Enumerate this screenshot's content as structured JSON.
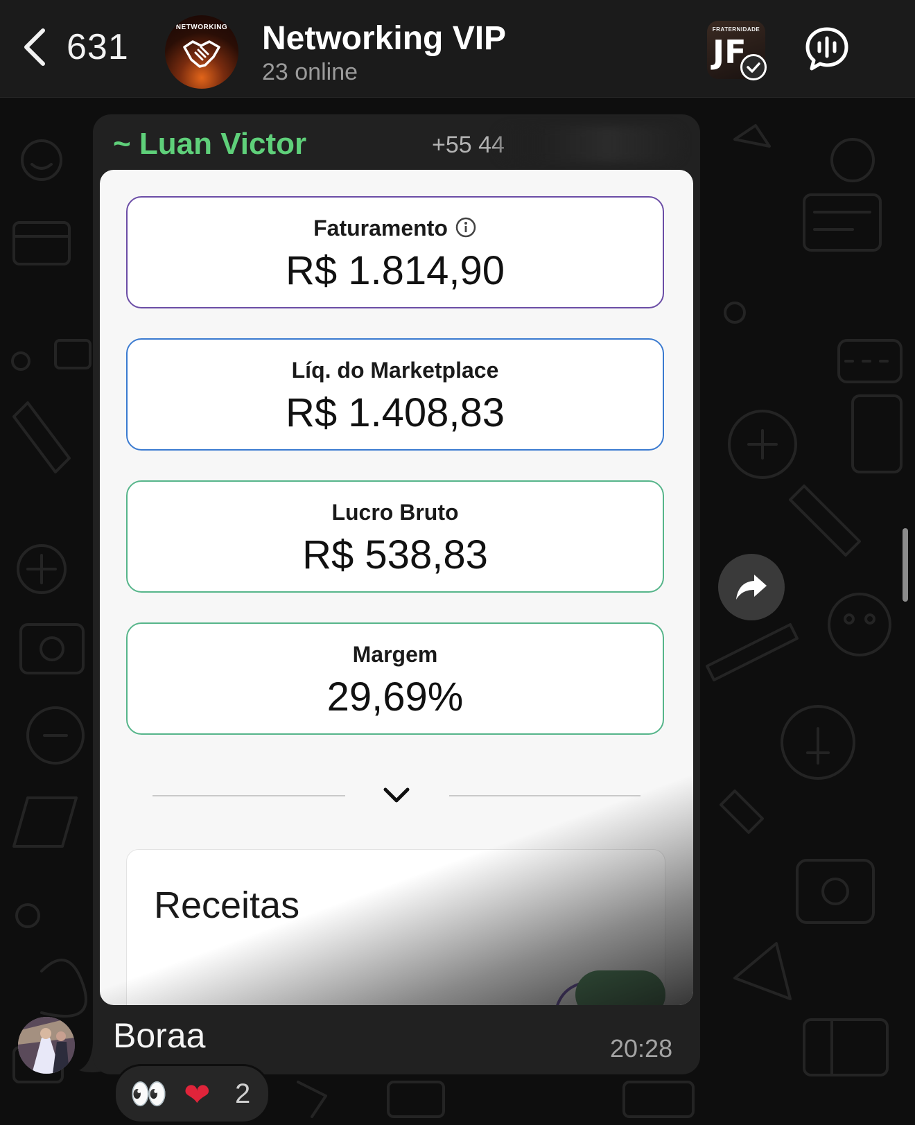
{
  "header": {
    "back_count": "631",
    "avatar_text": "NETWORKING",
    "title": "Networking VIP",
    "status": "23 online",
    "brand_top": "FRATERNIDADE",
    "brand_main": "JF"
  },
  "message": {
    "sender": "~ Luan Victor",
    "sender_phone": "+55 44",
    "text": "Boraa",
    "time": "20:28",
    "reactions": {
      "emoji_1": "👀",
      "emoji_2": "❤",
      "count": "2"
    }
  },
  "screenshot": {
    "cards": [
      {
        "label": "Faturamento",
        "value": "R$ 1.814,90"
      },
      {
        "label": "Líq. do Marketplace",
        "value": "R$ 1.408,83"
      },
      {
        "label": "Lucro Bruto",
        "value": "R$ 538,83"
      },
      {
        "label": "Margem",
        "value": "29,69%"
      }
    ],
    "section_title": "Receitas"
  },
  "colors": {
    "header_bg": "#1b1b1b",
    "chat_bg": "#0e0e0e",
    "bubble_bg": "#212121",
    "sender_green": "#5fd07a",
    "card_purple": "#6b4da6",
    "card_blue": "#3a7ad0",
    "card_green": "#56b58a"
  }
}
